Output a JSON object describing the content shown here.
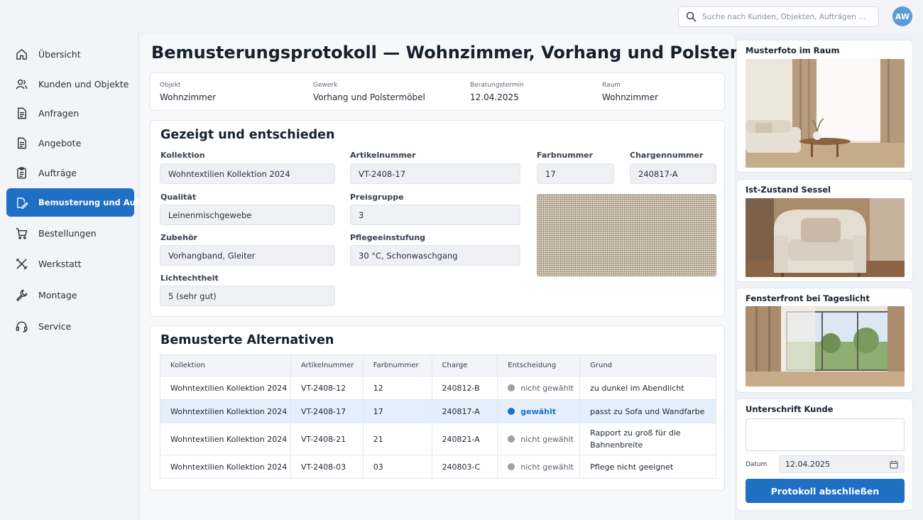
{
  "header": {
    "search_placeholder": "Suche nach Kunden, Objekten, Aufträgen ...",
    "avatar_initials": "AW",
    "avatar_color": "#5b9bd5"
  },
  "sidebar": {
    "items": [
      {
        "label": "Übersicht",
        "icon": "home-icon"
      },
      {
        "label": "Kunden und Objekte",
        "icon": "users-icon"
      },
      {
        "label": "Anfragen",
        "icon": "document-icon"
      },
      {
        "label": "Angebote",
        "icon": "document-icon"
      },
      {
        "label": "Aufträge",
        "icon": "clipboard-icon"
      },
      {
        "label": "Bemusterung und Aufmaß",
        "icon": "sample-edit-icon",
        "active": true
      },
      {
        "label": "Bestellungen",
        "icon": "cart-icon"
      },
      {
        "label": "Werkstatt",
        "icon": "tools-icon"
      },
      {
        "label": "Montage",
        "icon": "wrench-icon"
      },
      {
        "label": "Service",
        "icon": "headset-icon"
      }
    ]
  },
  "main": {
    "title": "Bemusterungsprotokoll — Wohnzimmer, Vorhang und Polstermöbel",
    "meta": {
      "objekt_label": "Objekt",
      "objekt_value": "Wohnzimmer",
      "gewerk_label": "Gewerk",
      "gewerk_value": "Vorhang und Polstermöbel",
      "termin_label": "Beratungstermin",
      "termin_value": "12.04.2025",
      "raum_label": "Raum",
      "raum_value": "Wohnzimmer"
    },
    "decided": {
      "title": "Gezeigt und entschieden",
      "kollektion_label": "Kollektion",
      "kollektion_value": "Wohntextilien Kollektion 2024",
      "artikelnummer_label": "Artikelnummer",
      "artikelnummer_value": "VT-2408-17",
      "farbnummer_label": "Farbnummer",
      "farbnummer_value": "17",
      "chargennummer_label": "Chargennummer",
      "chargennummer_value": "240817-A",
      "qualitaet_label": "Qualität",
      "qualitaet_value": "Leinenmischgewebe",
      "preisgruppe_label": "Preisgruppe",
      "preisgruppe_value": "3",
      "zubehoer_label": "Zubehör",
      "zubehoer_value": "Vorhangband, Gleiter",
      "pflege_label": "Pflegeeinstufung",
      "pflege_value": "30 °C, Schonwaschgang",
      "licht_label": "Lichtechtheit",
      "licht_value": "5 (sehr gut)"
    },
    "alternatives": {
      "title": "Bemusterte Alternativen",
      "columns": [
        "Kollektion",
        "Artikelnummer",
        "Farbnummer",
        "Charge",
        "Entscheidung",
        "Grund"
      ],
      "rows": [
        {
          "kollektion": "Wohntextilien Kollektion 2024",
          "artikel": "VT-2408-12",
          "farbe": "12",
          "charge": "240812-B",
          "entscheidung": "nicht gewählt",
          "grund": "zu dunkel im Abendlicht"
        },
        {
          "kollektion": "Wohntextilien Kollektion 2024",
          "artikel": "VT-2408-17",
          "farbe": "17",
          "charge": "240817-A",
          "entscheidung": "gewählt",
          "grund": "passt zu Sofa und Wandfarbe"
        },
        {
          "kollektion": "Wohntextilien Kollektion 2024",
          "artikel": "VT-2408-21",
          "farbe": "21",
          "charge": "240821-A",
          "entscheidung": "nicht gewählt",
          "grund": "Rapport zu groß für die Bahnenbreite"
        },
        {
          "kollektion": "Wohntextilien Kollektion 2024",
          "artikel": "VT-2408-03",
          "farbe": "03",
          "charge": "240803-C",
          "entscheidung": "nicht gewählt",
          "grund": "Pflege nicht geeignet"
        }
      ]
    }
  },
  "right": {
    "photo1_title": "Musterfoto im Raum",
    "photo2_title": "Ist-Zustand Sessel",
    "photo3_title": "Fensterfront bei Tageslicht",
    "signature_title": "Unterschrift Kunde",
    "date_label": "Datum",
    "date_value": "12.04.2025",
    "submit_label": "Protokoll abschließen"
  },
  "colors": {
    "accent": "#1f6fc5",
    "selected_row": "#e4effb",
    "not_chosen_dot": "#9aa1aa"
  }
}
